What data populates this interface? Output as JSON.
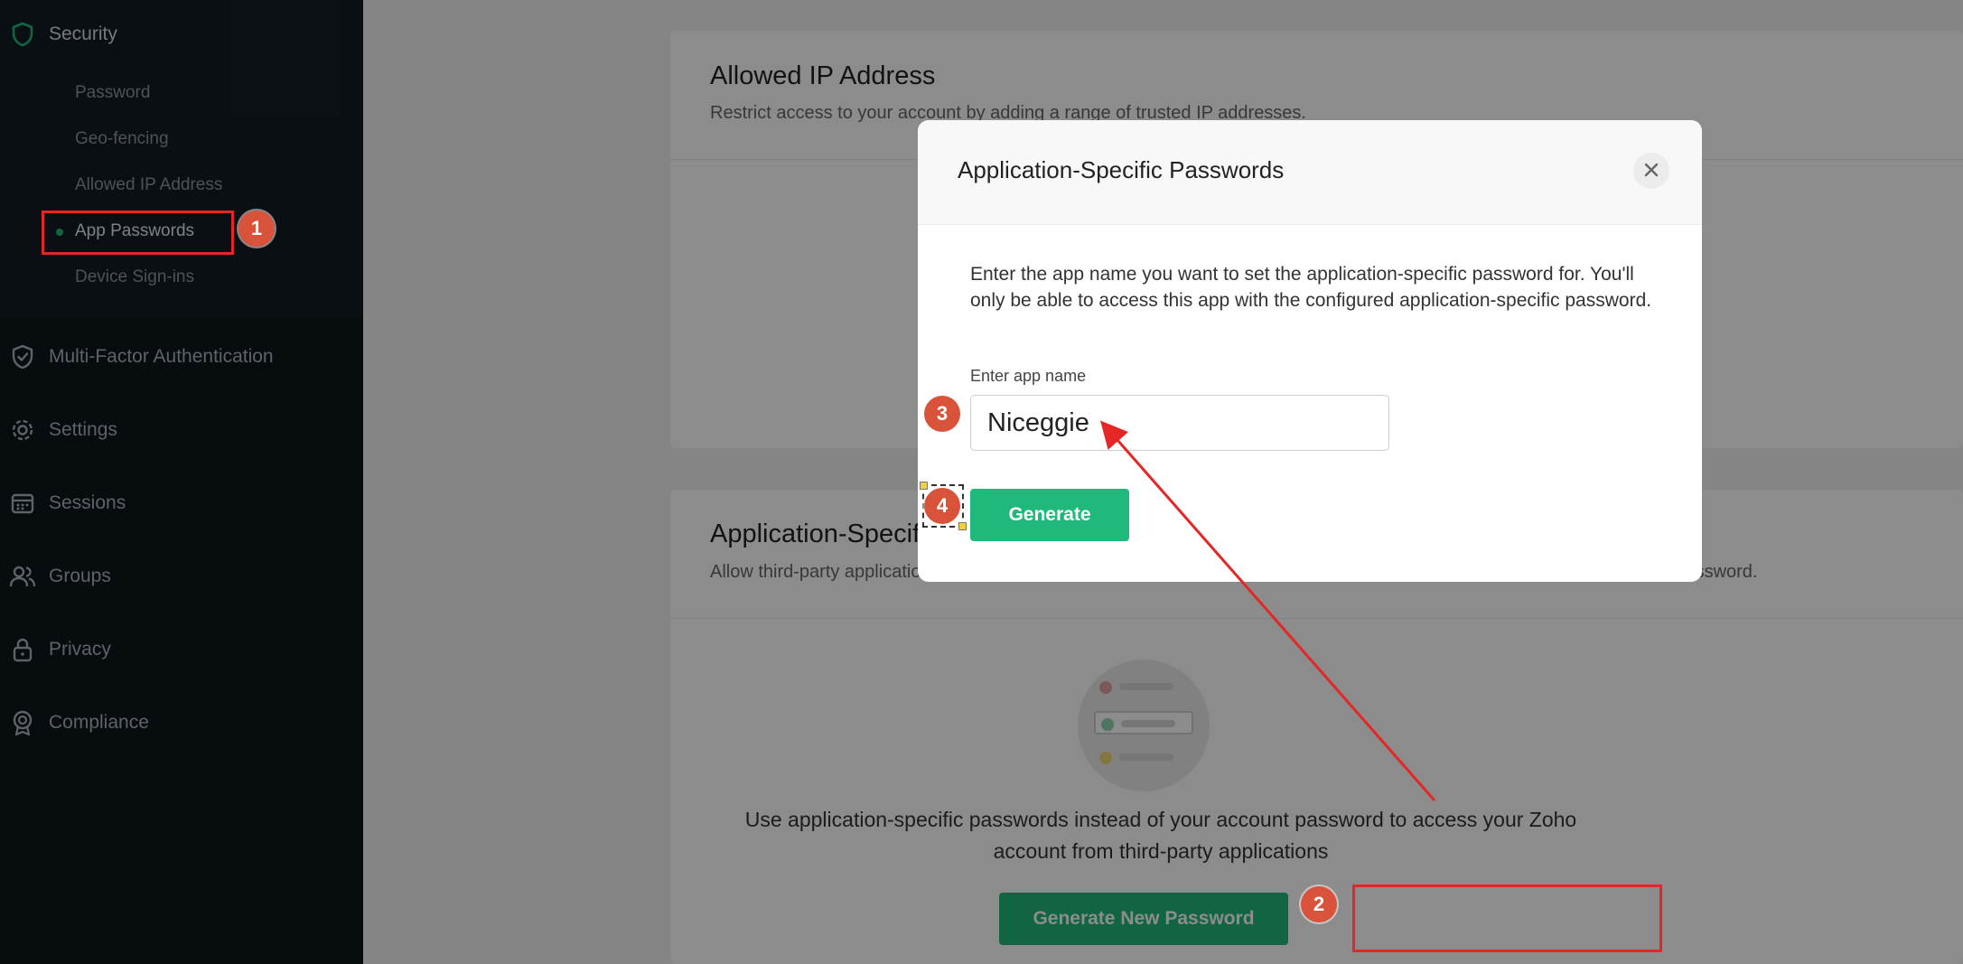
{
  "sidebar": {
    "security": {
      "label": "Security",
      "items": [
        {
          "label": "Password"
        },
        {
          "label": "Geo-fencing"
        },
        {
          "label": "Allowed IP Address"
        },
        {
          "label": "App Passwords"
        },
        {
          "label": "Device Sign-ins"
        }
      ]
    },
    "nav": [
      {
        "label": "Multi-Factor Authentication",
        "icon": "shield-check-icon"
      },
      {
        "label": "Settings",
        "icon": "gear-icon"
      },
      {
        "label": "Sessions",
        "icon": "calendar-icon"
      },
      {
        "label": "Groups",
        "icon": "users-icon"
      },
      {
        "label": "Privacy",
        "icon": "lock-icon"
      },
      {
        "label": "Compliance",
        "icon": "badge-icon"
      }
    ]
  },
  "main": {
    "allowed_ip": {
      "title": "Allowed IP Address",
      "subtitle": "Restrict access to your account by adding a range of trusted IP addresses."
    },
    "app_specific": {
      "title": "Application-Specific Passwords",
      "subtitle": "Allow third-party applications to access your Zoho account with an application-specific password instead of your account password.",
      "empty_text": "Use application-specific passwords instead of your account password to access your Zoho account from third-party applications",
      "generate_new_label": "Generate New Password"
    }
  },
  "modal": {
    "title": "Application-Specific Passwords",
    "description": "Enter the app name you want to set the application-specific password for. You'll only be able to access this app with the configured application-specific password.",
    "field_label": "Enter app name",
    "field_value": "Niceggie",
    "generate_label": "Generate"
  },
  "annotations": {
    "badges": [
      "1",
      "2",
      "3",
      "4"
    ],
    "color": "#e52626",
    "badge_color": "#d9533a"
  },
  "colors": {
    "accent": "#1fb97b",
    "sidebar_bg": "#0d161c"
  }
}
